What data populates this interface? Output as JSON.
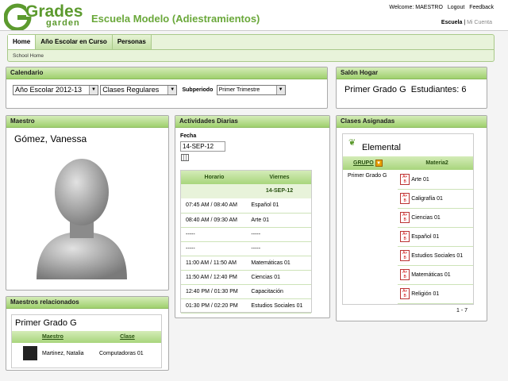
{
  "header": {
    "logo_top": "Grades",
    "logo_bottom": "garden",
    "school_name": "Escuela Modelo (Adiestramientos)",
    "welcome": "Welcome: MAESTRO",
    "logout": "Logout",
    "feedback": "Feedback",
    "escuela": "Escuela",
    "mi_cuenta": "Mi Cuenta"
  },
  "nav": {
    "tabs": [
      "Home",
      "Año Escolar en Curso",
      "Personas"
    ],
    "breadcrumb": "School Home"
  },
  "calendario": {
    "title": "Calendario",
    "year": "Año Escolar 2012-13",
    "clases": "Clases Regulares",
    "subperiodo_label": "Subperiodo",
    "subperiodo": "Primer Trimestre"
  },
  "salon": {
    "title": "Salón Hogar",
    "grupo": "Primer Grado G",
    "estudiantes": "Estudiantes: 6"
  },
  "maestro": {
    "title": "Maestro",
    "name": "Gómez, Vanessa"
  },
  "actividades": {
    "title": "Actividades Diarias",
    "fecha_label": "Fecha",
    "fecha": "14-SEP-12",
    "col_horario": "Horario",
    "col_dia": "Viernes",
    "date_header": "14-SEP-12",
    "rows": [
      [
        "07:45 AM / 08:40 AM",
        "Español 01"
      ],
      [
        "08:40 AM / 09:30 AM",
        "Arte 01"
      ],
      [
        "-----",
        "-----"
      ],
      [
        "-----",
        "-----"
      ],
      [
        "11:00 AM / 11:50 AM",
        "Matemáticas 01"
      ],
      [
        "11:50 AM / 12:40 PM",
        "Ciencias 01"
      ],
      [
        "12:40 PM / 01:30 PM",
        "Capacitación"
      ],
      [
        "01:30 PM / 02:20 PM",
        "Estudios Sociales 01"
      ]
    ]
  },
  "clases": {
    "title": "Clases Asignadas",
    "nivel": "Elemental",
    "col_grupo": "GRUPO",
    "col_materia": "Materia2",
    "grupo": "Primer Grado G",
    "badge_text": "A+ B",
    "materias": [
      "Arte 01",
      "Caligrafía 01",
      "Ciencias 01",
      "Español 01",
      "Estudios Sociales 01",
      "Matemáticas 01",
      "Religión 01"
    ],
    "pager": "1 - 7"
  },
  "relacionados": {
    "title": "Maestros relacionados",
    "grupo": "Primer Grado G",
    "col_maestro": "Maestro",
    "col_clase": "Clase",
    "rows": [
      [
        "Martinez, Natalia",
        "Computadoras 01"
      ]
    ]
  },
  "colors": {
    "accent_green": "#6aa83a",
    "header_green": "#9fd06e"
  }
}
